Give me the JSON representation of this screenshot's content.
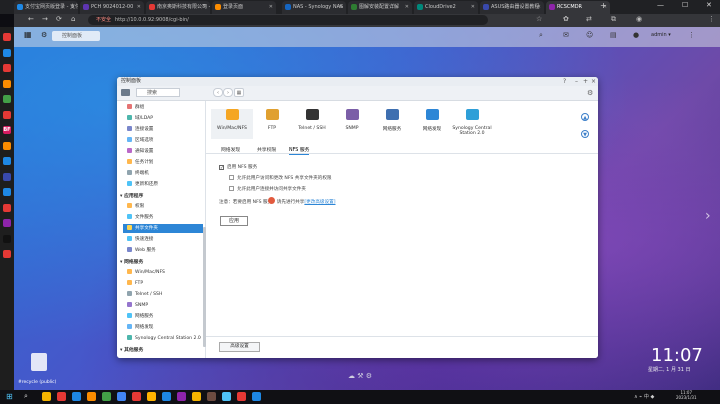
{
  "browser": {
    "tabs": [
      {
        "label": "支付宝网页版登录 - 支付",
        "color": "#1e88e5"
      },
      {
        "label": "PCH 9024012-00",
        "color": "#5e35b1"
      },
      {
        "label": "南京奥斯科技有限公司 - 主页",
        "color": "#e53935"
      },
      {
        "label": "登录页面",
        "color": "#fb8c00"
      },
      {
        "label": "NAS - Synology NAS",
        "color": "#1565c0"
      },
      {
        "label": "图解安装配置详解",
        "color": "#2e7d32"
      },
      {
        "label": "CloudDrive2",
        "color": "#00897b"
      },
      {
        "label": "ASUS路由器设置教程",
        "color": "#3949ab"
      },
      {
        "label": "RCSCMDR",
        "color": "#8e24aa"
      }
    ],
    "active_tab_index": 8,
    "url_warning": "不安全",
    "url": "http://10.0.0.92:9008/cgi-bin/",
    "new_tab": "+",
    "win_min": "—",
    "win_max": "☐",
    "win_close": "✕"
  },
  "rail_icons": [
    {
      "name": "tabs-icon",
      "label": "",
      "color": "#e53935"
    },
    {
      "name": "app-icon-1",
      "label": "",
      "color": "#1e88e5"
    },
    {
      "name": "app-icon-2",
      "label": "",
      "color": "#e53935"
    },
    {
      "name": "app-icon-3",
      "label": "",
      "color": "#fb8c00"
    },
    {
      "name": "app-icon-4",
      "label": "",
      "color": "#43a047"
    },
    {
      "name": "app-icon-5",
      "label": "",
      "color": "#e53935"
    },
    {
      "name": "bf-icon",
      "label": "BF",
      "color": "#d81b60"
    },
    {
      "name": "app-icon-6",
      "label": "",
      "color": "#fb8c00"
    },
    {
      "name": "app-icon-7",
      "label": "",
      "color": "#1e88e5"
    },
    {
      "name": "app-icon-8",
      "label": "",
      "color": "#3949ab"
    },
    {
      "name": "app-icon-9",
      "label": "",
      "color": "#1e88e5"
    },
    {
      "name": "app-icon-10",
      "label": "",
      "color": "#e53935"
    },
    {
      "name": "app-icon-11",
      "label": "",
      "color": "#8e24aa"
    },
    {
      "name": "tiktok-icon",
      "label": "",
      "color": "#111111"
    },
    {
      "name": "app-icon-12",
      "label": "",
      "color": "#e53935"
    }
  ],
  "dsm": {
    "search_label": "控制面板",
    "user": "admin ▾",
    "clock": "11:07",
    "date": "星期二, 1 月 31 日",
    "recycle_label": "#recycle (public)",
    "dock_icons": "☁ ⚒ ⚙"
  },
  "window": {
    "title": "控制面板",
    "search_placeholder": "搜索",
    "sidebar": {
      "items_top": [
        {
          "label": "群组",
          "color": "#e57373"
        },
        {
          "label": "域/LDAP",
          "color": "#4db6ac"
        },
        {
          "label": "连接设置",
          "color": "#7986cb"
        },
        {
          "label": "区域选项",
          "color": "#64b5f6"
        },
        {
          "label": "通知设置",
          "color": "#ba68c8"
        },
        {
          "label": "任务计划",
          "color": "#ffb74d"
        },
        {
          "label": "终端机",
          "color": "#90a4ae"
        },
        {
          "label": "更新和还原",
          "color": "#4fc3f7"
        }
      ],
      "section_services": "应用程序",
      "items_services": [
        {
          "label": "权限",
          "color": "#ffb74d"
        },
        {
          "label": "文件服务",
          "color": "#4fc3f7"
        },
        {
          "label": "共享文件夹",
          "color": "#ffd54f",
          "selected": true
        },
        {
          "label": "快速连接",
          "color": "#4fc3f7"
        },
        {
          "label": "Web 服务",
          "color": "#7986cb"
        }
      ],
      "section_network": "网络服务",
      "items_network": [
        {
          "label": "Win/Mac/NFS",
          "color": "#ffb74d"
        },
        {
          "label": "FTP",
          "color": "#ffb74d"
        },
        {
          "label": "Telnet / SSH",
          "color": "#90a4ae"
        },
        {
          "label": "SNMP",
          "color": "#9575cd"
        },
        {
          "label": "网络服务",
          "color": "#4fc3f7"
        },
        {
          "label": "网络发现",
          "color": "#64b5f6"
        },
        {
          "label": "Synology Central Station 2.0",
          "color": "#4db6ac"
        }
      ],
      "section_bottom": "其他服务"
    },
    "apps": [
      {
        "label": "Win/Mac/NFS",
        "color": "#f5a623",
        "selected": true
      },
      {
        "label": "FTP",
        "color": "#e0a030"
      },
      {
        "label": "Telnet / SSH",
        "color": "#333333"
      },
      {
        "label": "SNMP",
        "color": "#7b5ea7"
      },
      {
        "label": "网络服务",
        "color": "#3e6fb0"
      },
      {
        "label": "网络发现",
        "color": "#2d86d6"
      },
      {
        "label": "Synology Central Station 2.0",
        "color": "#2e9fd8"
      }
    ],
    "tabs": [
      "网络发现",
      "共享权限",
      "NFS 服务"
    ],
    "active_tab": 2,
    "options": [
      {
        "label": "启用 NFS 服务",
        "checked": true
      },
      {
        "label": "允许此用户访问和更改 NFS 共享文件夹的权限",
        "checked": false
      },
      {
        "label": "允许此用户连接并访问共享文件夹",
        "checked": false
      }
    ],
    "note_prefix": "注意：",
    "note_text": "若要启用 NFS 服务，请先进行共享",
    "note_link": "[更改高级设置]",
    "apply_label": "应用",
    "advanced_label": "高级设置",
    "scroll_up": "▲",
    "scroll_down": "▼"
  },
  "taskbar": {
    "time": "11:07",
    "date": "2023/1/31",
    "tray": "∧ ⌁ 中 ◆"
  }
}
